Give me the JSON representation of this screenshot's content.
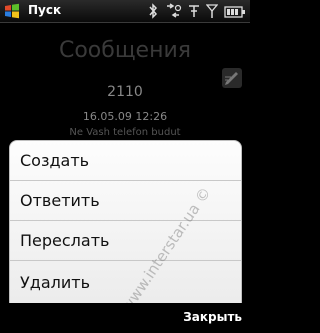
{
  "status_bar": {
    "start_label": "Пуск",
    "icons": [
      "windows-logo-icon",
      "bluetooth-icon",
      "sync-icon",
      "network-icon",
      "signal-icon",
      "battery-icon"
    ]
  },
  "header": {
    "title": "Сообщения"
  },
  "message": {
    "from": "2110",
    "date": "16.05.09 12:26",
    "preview": "Ne Vash telefon budut"
  },
  "context_menu": {
    "items": [
      {
        "label": "Создать"
      },
      {
        "label": "Ответить"
      },
      {
        "label": "Переслать"
      },
      {
        "label": "Удалить"
      }
    ]
  },
  "watermark": {
    "text": "www.interstar.ua ©"
  },
  "softkeys": {
    "right": "Закрыть"
  },
  "colors": {
    "menu_bg": "#f2f2f2",
    "background": "#000000"
  }
}
